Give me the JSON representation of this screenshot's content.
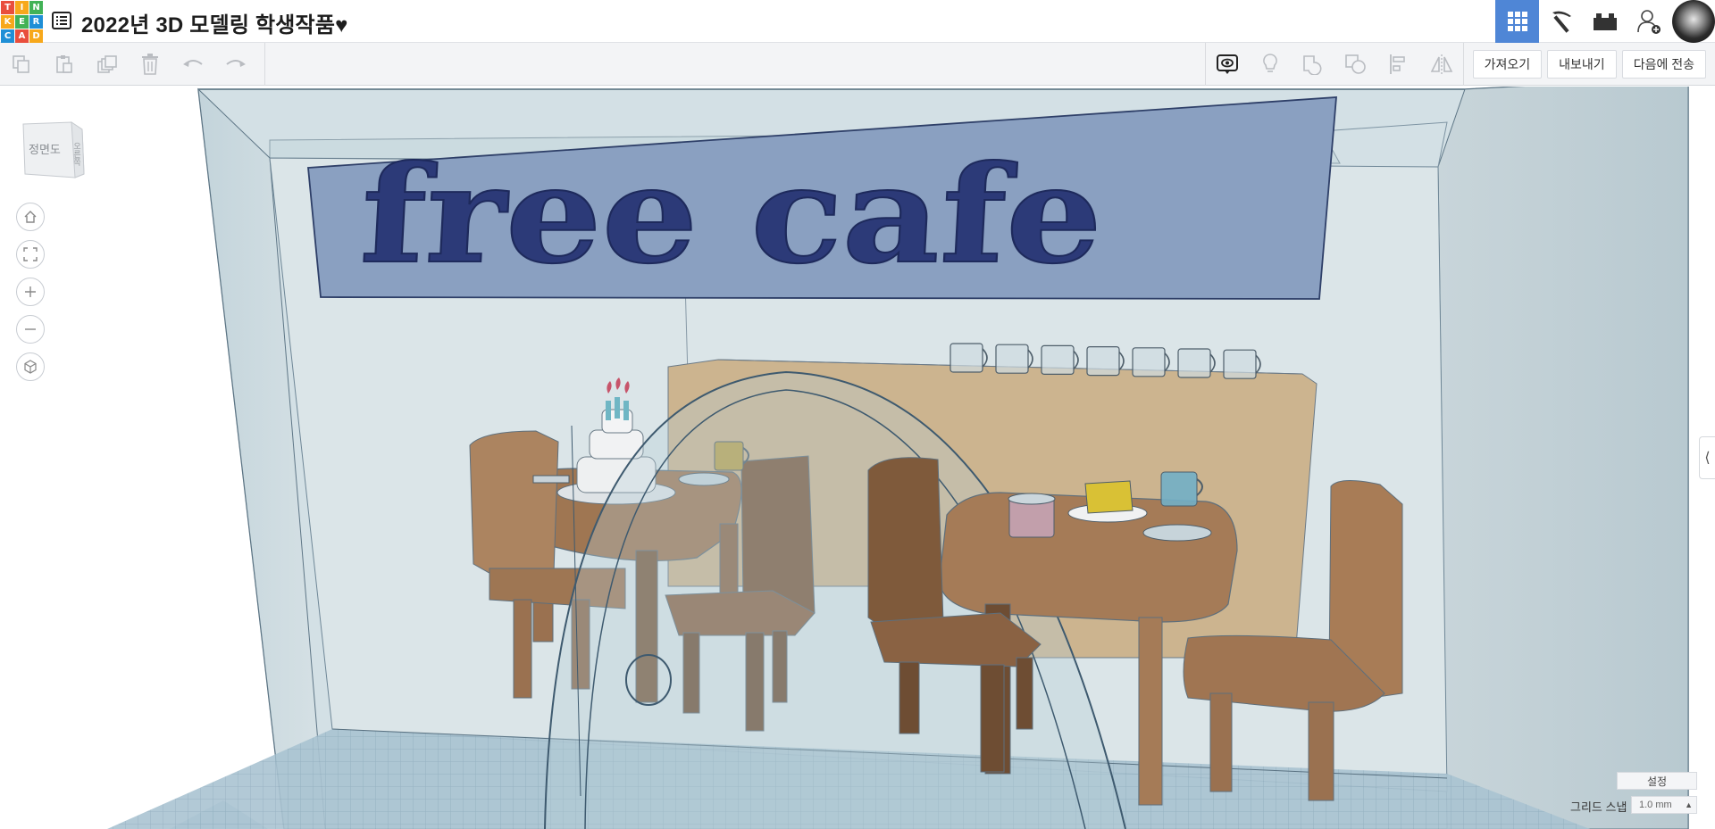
{
  "app": {
    "logo_letters": [
      "T",
      "I",
      "N",
      "K",
      "E",
      "R",
      "C",
      "A",
      "D"
    ],
    "logo_colors": [
      "#e94e3d",
      "#f7a81b",
      "#42b256",
      "#f7a81b",
      "#42b256",
      "#1f8fd6",
      "#1f8fd6",
      "#e94e3d",
      "#f7a81b"
    ],
    "design_title": "2022년 3D 모델링 학생작품♥",
    "accent_color": "#4f86d6"
  },
  "header": {
    "icons": [
      "grid-view-icon",
      "pickaxe-icon",
      "brick-icon",
      "invite-user-icon",
      "user-avatar"
    ]
  },
  "toolbar": {
    "edit_icons": [
      "copy-icon",
      "paste-icon",
      "duplicate-icon",
      "delete-icon",
      "undo-icon",
      "redo-icon"
    ],
    "view_icons": [
      "notes-icon",
      "light-icon",
      "group-icon",
      "ungroup-icon",
      "align-icon",
      "mirror-icon"
    ],
    "import_label": "가져오기",
    "export_label": "내보내기",
    "send_to_label": "다음에 전송"
  },
  "viewcube": {
    "front_label": "정면도",
    "right_label": "오른쪽"
  },
  "navigation": {
    "buttons": [
      "home-view-icon",
      "fit-view-icon",
      "zoom-in-icon",
      "zoom-out-icon",
      "perspective-icon"
    ]
  },
  "scene": {
    "sign_text": "free cafe",
    "mug_count": 7
  },
  "workplane": {
    "settings_label": "설정",
    "snap_grid_label": "그리드 스냅",
    "snap_value": "1.0 mm"
  }
}
